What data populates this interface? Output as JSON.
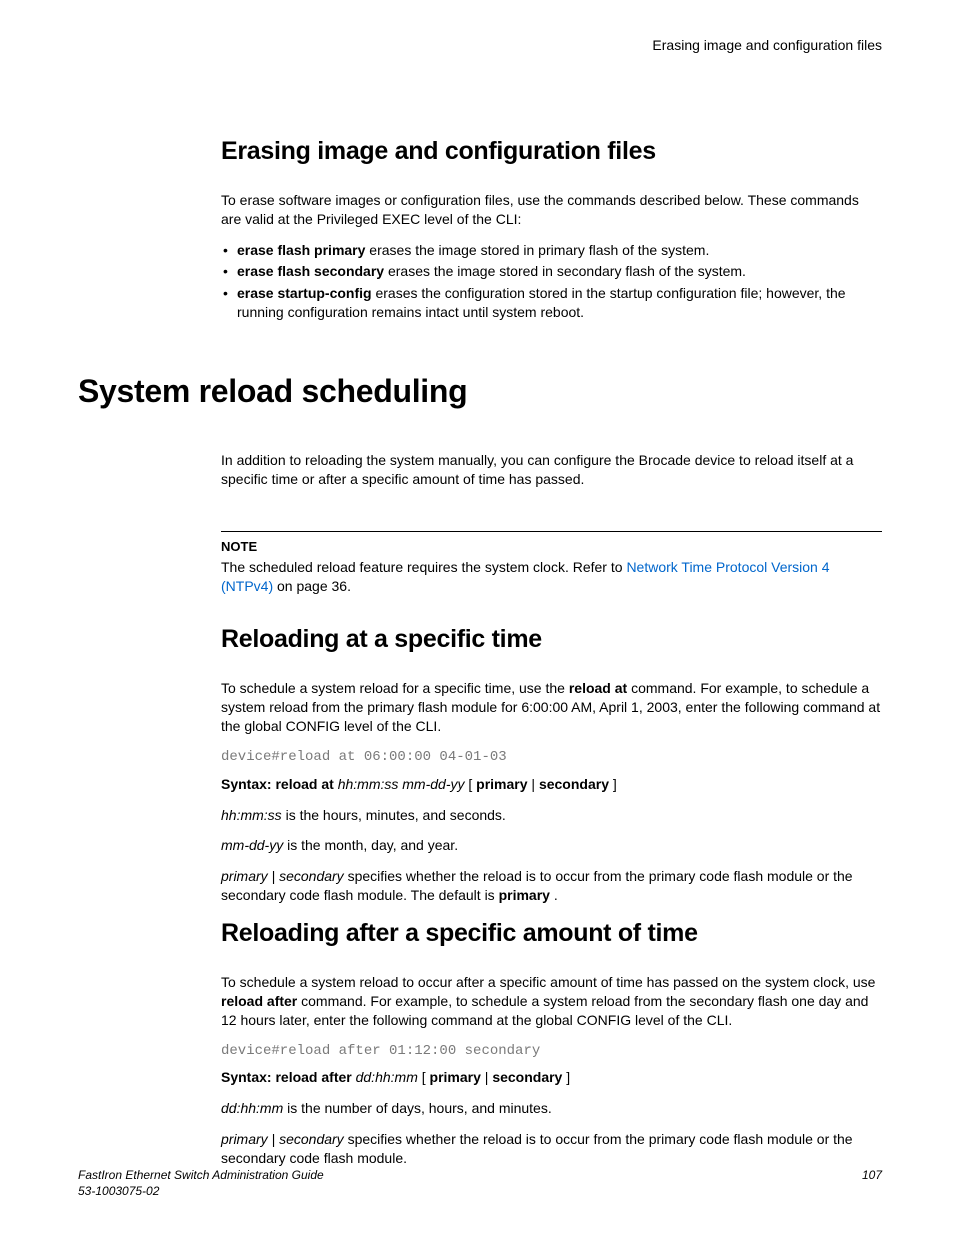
{
  "runningHeader": "Erasing image and configuration files",
  "sec1": {
    "title": "Erasing image and configuration files",
    "intro": "To erase software images or configuration files, use the commands described below. These commands are valid at the Privileged EXEC level of the CLI:",
    "b1_cmd": "erase flash primary",
    "b1_rest": " erases the image stored in primary flash of the system.",
    "b2_cmd": "erase flash secondary",
    "b2_rest": " erases the image stored in secondary flash of the system.",
    "b3_cmd": "erase startup-config",
    "b3_rest": " erases the configuration stored in the startup configuration file; however, the running configuration remains intact until system reboot."
  },
  "majorTitle": "System reload scheduling",
  "majorIntro": "In addition to reloading the system manually, you can configure the Brocade device to reload itself at a specific time or after a specific amount of time has passed.",
  "note": {
    "label": "NOTE",
    "pre": "The scheduled reload feature requires the system clock. Refer to ",
    "link": "Network Time Protocol Version 4 (NTPv4)",
    "post": " on page 36."
  },
  "sec2": {
    "title": "Reloading at a specific time",
    "p1a": "To schedule a system reload for a specific time, use the ",
    "p1_cmd": "reload at",
    "p1b": " command. For example, to schedule a system reload from the primary flash module for 6:00:00 AM, April 1, 2003, enter the following command at the global CONFIG level of the CLI.",
    "code": "device#reload at 06:00:00 04-01-03",
    "syntax_label": "Syntax: reload at ",
    "syntax_var": "hh:mm:ss mm-dd-yy",
    "syntax_mid": " [ ",
    "syntax_p": "primary",
    "syntax_bar": " | ",
    "syntax_s": "secondary",
    "syntax_end": " ]",
    "d1_var": "hh:mm:ss",
    "d1_rest": " is the hours, minutes, and seconds.",
    "d2_var": "mm-dd-yy",
    "d2_rest": " is the month, day, and year.",
    "d3_var": "primary | secondary",
    "d3_rest_a": " specifies whether the reload is to occur from the primary code flash module or the secondary code flash module. The default is ",
    "d3_bold": "primary",
    "d3_rest_b": " ."
  },
  "sec3": {
    "title": "Reloading after a specific amount of time",
    "p1a": "To schedule a system reload to occur after a specific amount of time has passed on the system clock, use ",
    "p1_cmd": "reload after",
    "p1b": " command. For example, to schedule a system reload from the secondary flash one day and 12 hours later, enter the following command at the global CONFIG level of the CLI.",
    "code": "device#reload after 01:12:00 secondary",
    "syntax_label": "Syntax: reload after ",
    "syntax_var": "dd:hh:mm",
    "syntax_mid": " [ ",
    "syntax_p": "primary",
    "syntax_bar": " | ",
    "syntax_s": "secondary",
    "syntax_end": " ]",
    "d1_var": "dd:hh:mm",
    "d1_rest": " is the number of days, hours, and minutes.",
    "d2_var": "primary | secondary",
    "d2_rest": " specifies whether the reload is to occur from the primary code flash module or the secondary code flash module."
  },
  "footer": {
    "title": "FastIron Ethernet Switch Administration Guide",
    "docnum": "53-1003075-02",
    "page": "107"
  }
}
